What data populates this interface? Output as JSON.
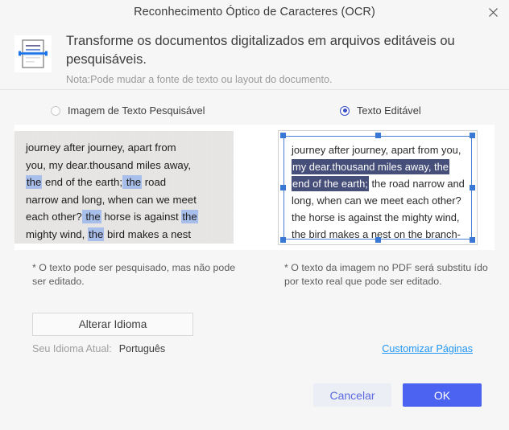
{
  "window": {
    "title": "Reconhecimento Óptico de Caracteres (OCR)",
    "close_icon": "close-icon"
  },
  "header": {
    "icon": "scanned-document-icon",
    "title": "Transforme os documentos digitalizados em arquivos editáveis ou pesquisáveis.",
    "note": "Nota:Pode mudar a fonte de texto ou layout do documento."
  },
  "modes": {
    "searchable": {
      "label": "Imagem de Texto Pesquisável",
      "selected": false
    },
    "editable": {
      "label": "Texto Editável",
      "selected": true
    }
  },
  "preview_left": {
    "lines": [
      [
        {
          "t": "journey after journey, apart from",
          "h": "none"
        }
      ],
      [
        {
          "t": "you, my dear.thousand miles away,",
          "h": "none"
        }
      ],
      [
        {
          "t": "the",
          "h": "light"
        },
        {
          "t": " end of the earth;",
          "h": "none"
        },
        {
          "t": " the",
          "h": "light"
        },
        {
          "t": " road",
          "h": "none"
        }
      ],
      [
        {
          "t": "narrow and long, when can we meet",
          "h": "none"
        }
      ],
      [
        {
          "t": "each other?",
          "h": "none"
        },
        {
          "t": " the",
          "h": "light"
        },
        {
          "t": " horse is against ",
          "h": "none"
        },
        {
          "t": "the",
          "h": "light"
        }
      ],
      [
        {
          "t": "mighty wind, ",
          "h": "none"
        },
        {
          "t": "the",
          "h": "light"
        },
        {
          "t": " bird makes a nest",
          "h": "none"
        }
      ]
    ],
    "caption": "* O texto pode ser pesquisado, mas não pode ser editado."
  },
  "preview_right": {
    "lines": [
      [
        {
          "t": "journey after journey, apart from you,",
          "h": "none"
        }
      ],
      [
        {
          "t": "my dear.thousand miles away, the",
          "h": "dark"
        }
      ],
      [
        {
          "t": "end of the earth;",
          "h": "dark"
        },
        {
          "t": " the road narrow and",
          "h": "none"
        }
      ],
      [
        {
          "t": "long, when can we meet each other?",
          "h": "none"
        }
      ],
      [
        {
          "t": "the horse is against the mighty wind,",
          "h": "none"
        }
      ],
      [
        {
          "t": "the bird makes a nest on the branch-",
          "h": "none"
        }
      ]
    ],
    "caption": "* O texto da imagem no PDF será substitu ído por texto real que pode ser editado.",
    "selection_handles": 8
  },
  "language": {
    "change_button": "Alterar Idioma",
    "current_label": "Seu Idioma Atual:",
    "current_value": "Português"
  },
  "links": {
    "customize_pages": "Customizar Páginas"
  },
  "footer": {
    "cancel": "Cancelar",
    "ok": "OK"
  },
  "colors": {
    "accent": "#4c63f2",
    "cancel_text": "#5b6ae0",
    "link": "#2196f3",
    "highlight_light": "#a9bfeb",
    "highlight_dark": "#464e7a",
    "handle": "#3a78d6",
    "selection_border": "#4a7fd4",
    "dialog_bg": "#f6f6f6"
  }
}
